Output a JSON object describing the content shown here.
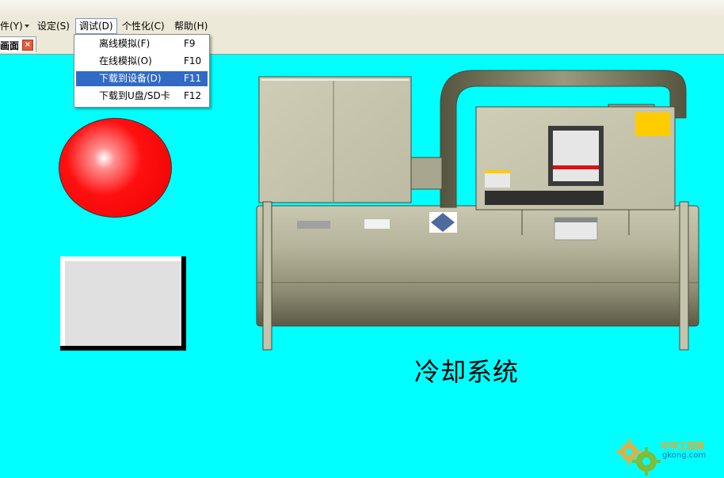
{
  "menubar": {
    "items": [
      "件(Y)",
      "设定(S)",
      "调试(D)",
      "个性化(C)",
      "帮助(H)"
    ],
    "active_index": 2
  },
  "tab": {
    "label": "画面",
    "close_glyph": "×"
  },
  "debug_menu": {
    "items": [
      {
        "label": "离线模拟(F)",
        "shortcut": "F9"
      },
      {
        "label": "在线模拟(O)",
        "shortcut": "F10"
      },
      {
        "label": "下载到设备(D)",
        "shortcut": "F11"
      },
      {
        "label": "下载到U盘/SD卡",
        "shortcut": "F12"
      }
    ],
    "highlighted_index": 2
  },
  "canvas": {
    "title": "冷却系统",
    "background_color": "#00ffff",
    "indicator_lamp_color": "#ff0000"
  },
  "watermark": {
    "cn": "中华工控网",
    "en": "gkong.com"
  },
  "icons": [
    "dropdown-arrow-icon",
    "close-icon",
    "gear-icon"
  ]
}
